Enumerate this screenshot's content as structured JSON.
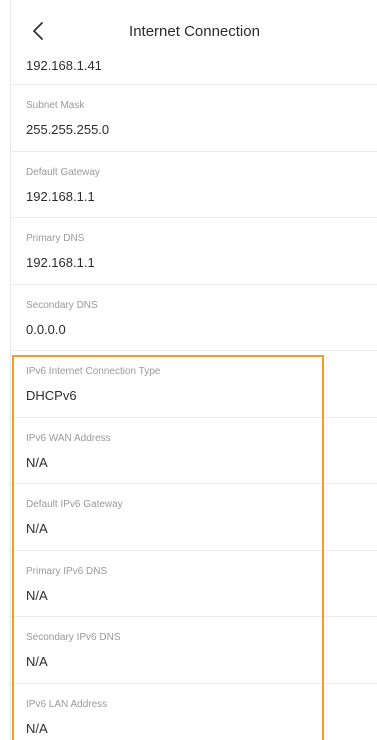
{
  "header": {
    "title": "Internet Connection",
    "back_icon": "chevron-left-icon"
  },
  "top_value": "192.168.1.41",
  "rows": [
    {
      "label": "Subnet Mask",
      "value": "255.255.255.0"
    },
    {
      "label": "Default Gateway",
      "value": "192.168.1.1"
    },
    {
      "label": "Primary DNS",
      "value": "192.168.1.1"
    },
    {
      "label": "Secondary DNS",
      "value": "0.0.0.0"
    },
    {
      "label": "IPv6 Internet Connection Type",
      "value": "DHCPv6"
    },
    {
      "label": "IPv6 WAN Address",
      "value": "N/A"
    },
    {
      "label": "Default IPv6 Gateway",
      "value": "N/A"
    },
    {
      "label": "Primary IPv6 DNS",
      "value": "N/A"
    },
    {
      "label": "Secondary IPv6 DNS",
      "value": "N/A"
    },
    {
      "label": "IPv6 LAN Address",
      "value": "N/A"
    }
  ],
  "colors": {
    "highlight": "#f39a2c",
    "label": "#9a9a9a",
    "value": "#2c2c2c"
  }
}
